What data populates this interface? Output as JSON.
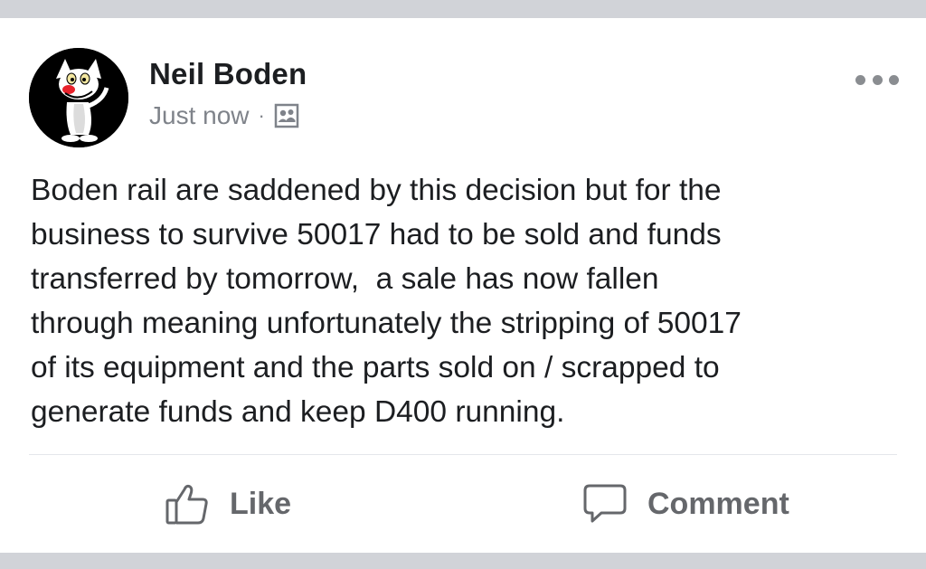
{
  "post": {
    "author": "Neil Boden",
    "timestamp": "Just now",
    "separator": "·",
    "audience_icon": "friends-audience-icon",
    "body": "Boden rail are saddened by this decision but for the\nbusiness to survive 50017 had to be sold and funds\ntransferred by tomorrow,  a sale has now fallen\nthrough meaning unfortunately the stripping of 50017\nof its equipment and the parts sold on / scrapped to\ngenerate funds and keep D400 running."
  },
  "actions": {
    "like_label": "Like",
    "comment_label": "Comment"
  },
  "colors": {
    "background": "#d1d3d8",
    "card": "#ffffff",
    "text": "#1c1e21",
    "secondary_text": "#7f838a",
    "action_text": "#65676b"
  }
}
